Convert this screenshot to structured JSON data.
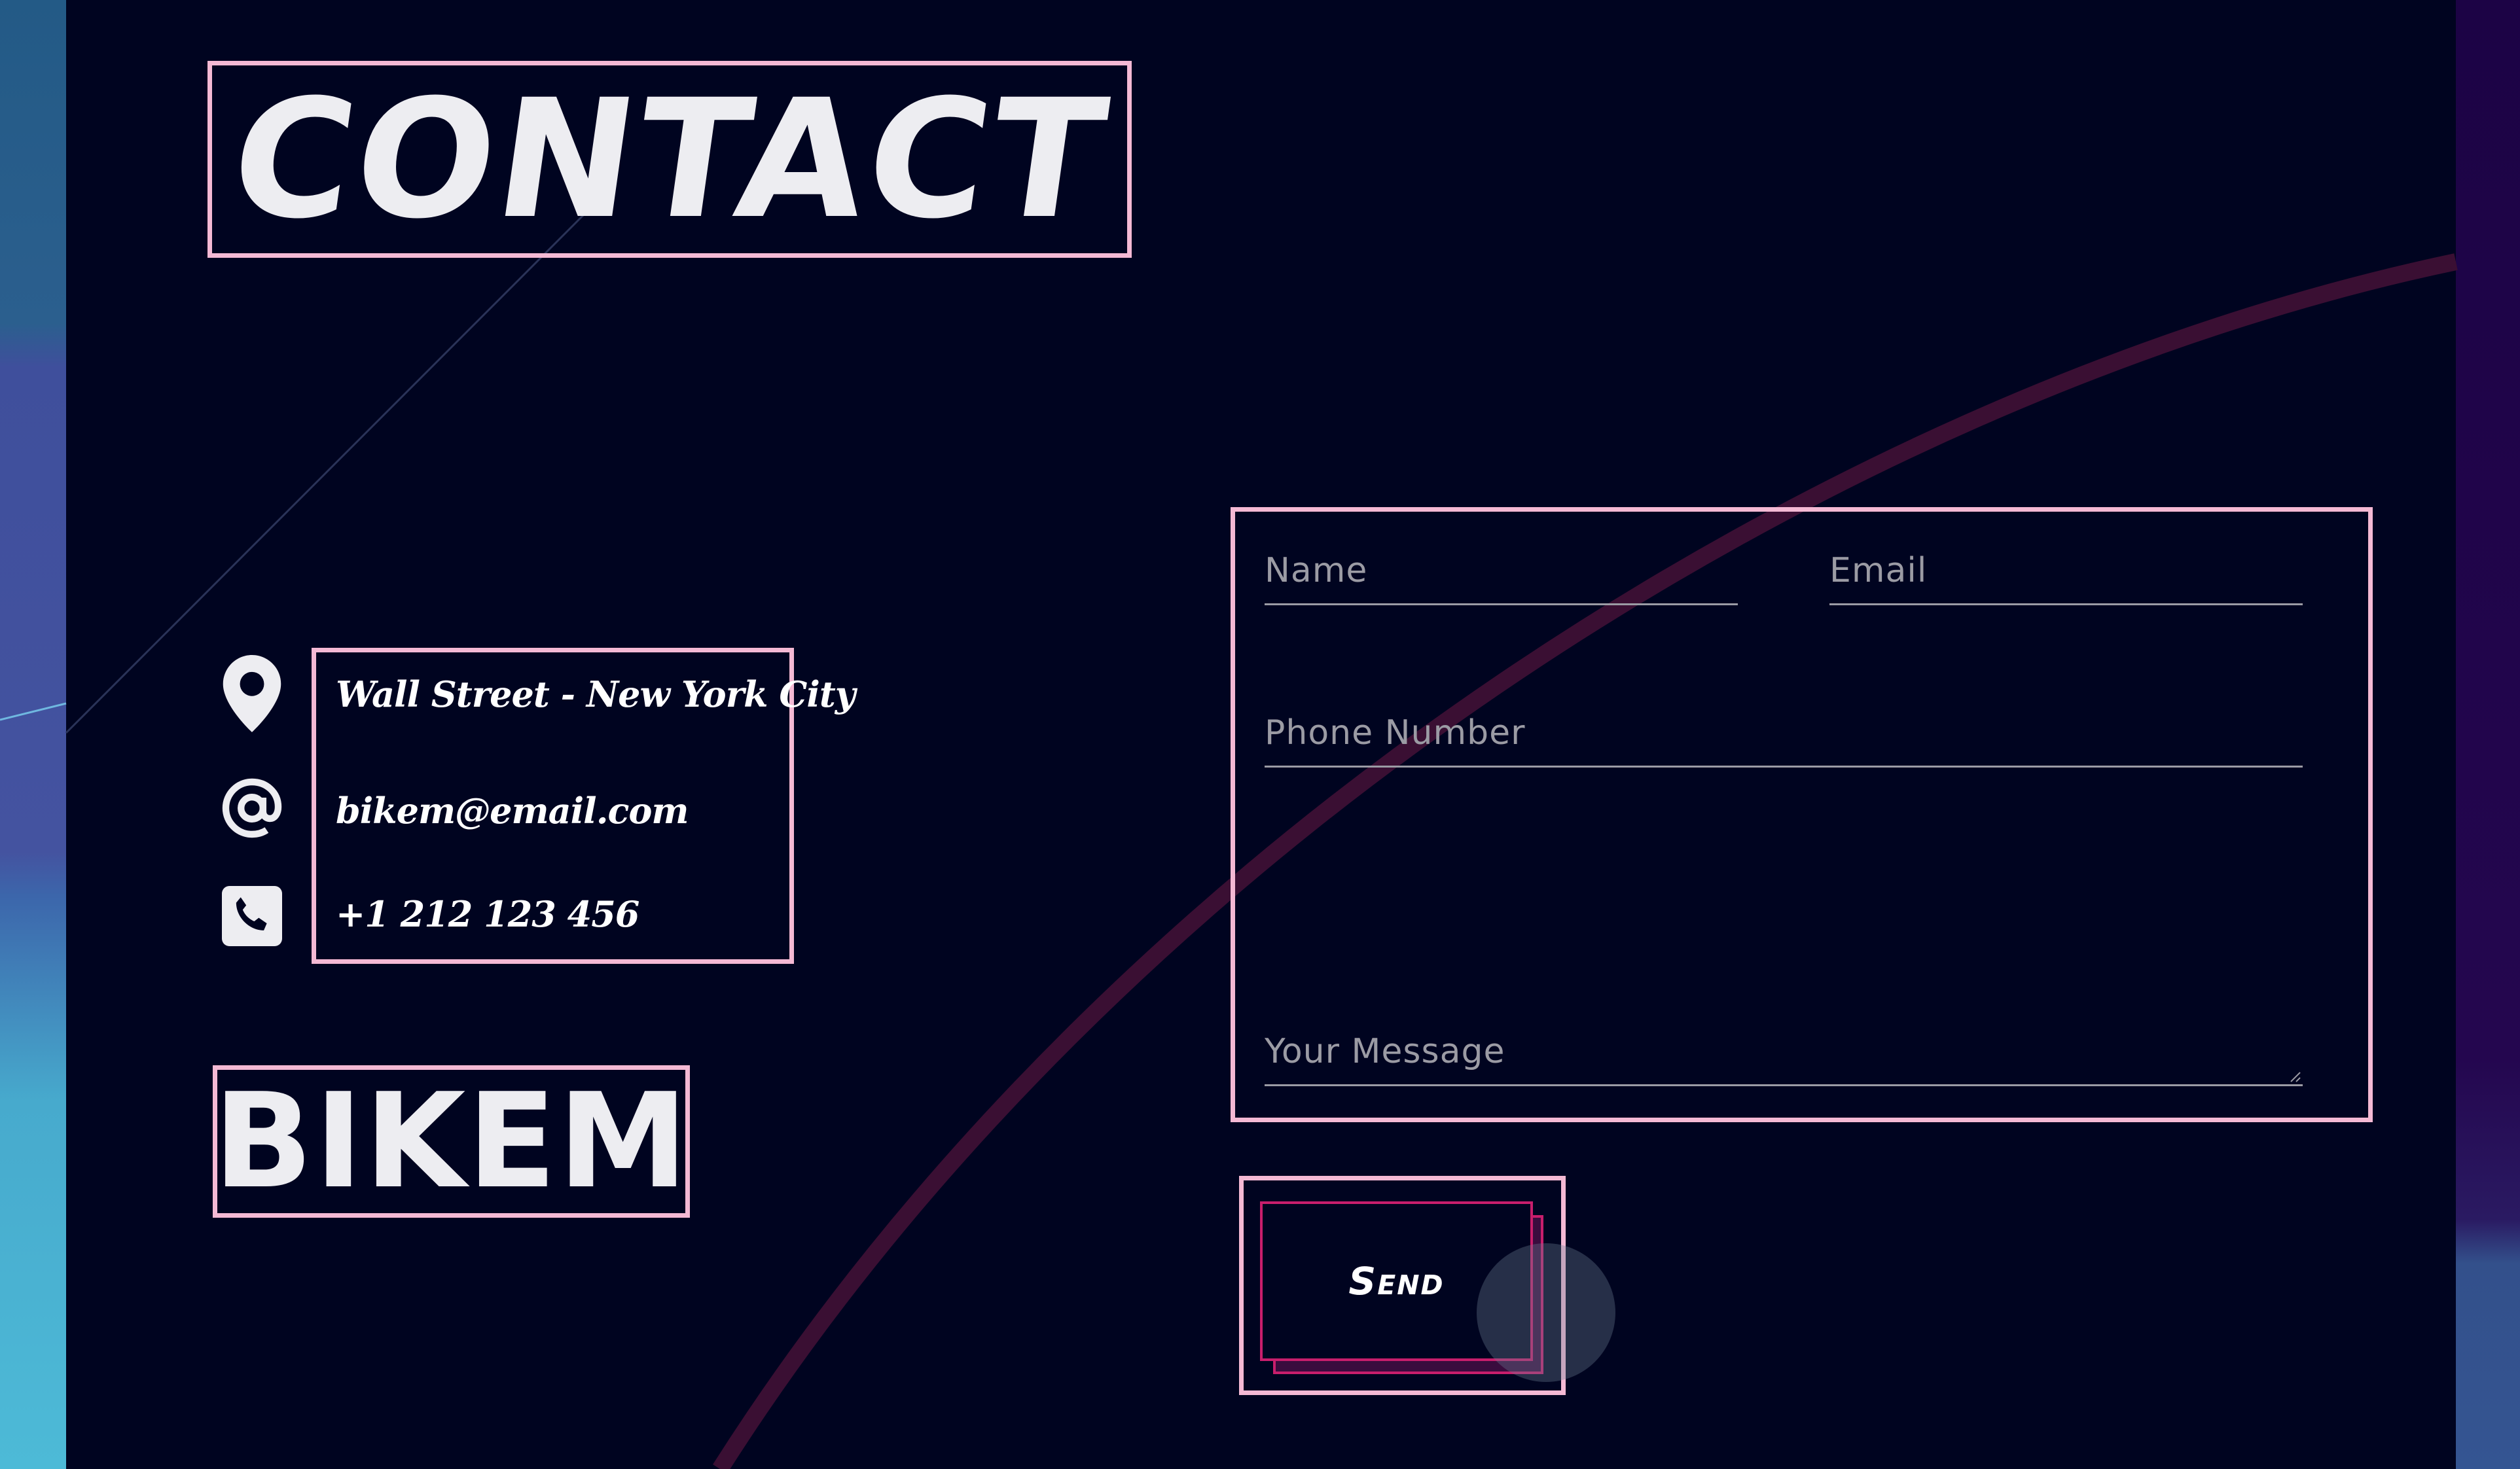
{
  "colors": {
    "background": "#000420",
    "frame": "#f4b9d4",
    "text": "#ededf1",
    "placeholder": "#9b9ba4",
    "button_border": "#c81e6c",
    "deco_arc": "#3a0f33"
  },
  "header": {
    "title": "CONTACT"
  },
  "contact_info": {
    "items": [
      {
        "icon": "location-pin-icon",
        "text": "Wall Street - New York City"
      },
      {
        "icon": "at-sign-icon",
        "text": "bikem@email.com"
      },
      {
        "icon": "phone-icon",
        "text": "+1 212 123 456"
      }
    ]
  },
  "brand": {
    "name": "BIKEM"
  },
  "form": {
    "name_placeholder": "Name",
    "email_placeholder": "Email",
    "phone_placeholder": "Phone Number",
    "message_placeholder": "Your Message",
    "send_label": "Send"
  }
}
